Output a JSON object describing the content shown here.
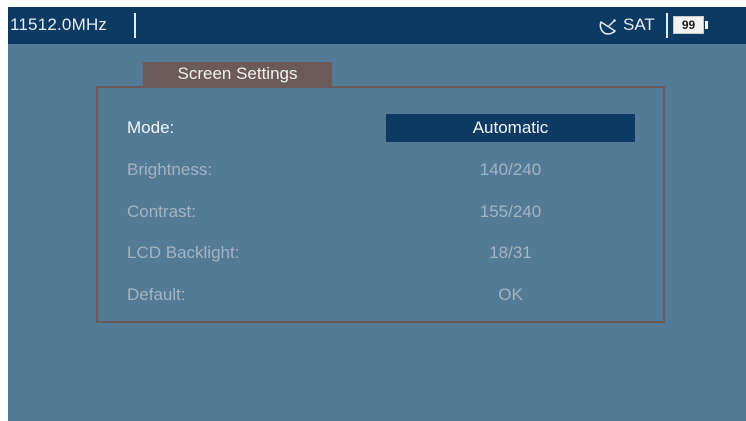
{
  "status_bar": {
    "frequency": "11512.0MHz",
    "mode": "SAT",
    "battery": "99",
    "satellite_icon": "satellite-dish-icon",
    "battery_icon": "battery-icon"
  },
  "panel": {
    "title": "Screen Settings",
    "rows": [
      {
        "label": "Mode:",
        "value": "Automatic",
        "selected": true
      },
      {
        "label": "Brightness:",
        "value": "140/240",
        "selected": false
      },
      {
        "label": "Contrast:",
        "value": "155/240",
        "selected": false
      },
      {
        "label": "LCD Backlight:",
        "value": "18/31",
        "selected": false
      },
      {
        "label": "Default:",
        "value": "OK",
        "selected": false
      }
    ]
  },
  "colors": {
    "background": "#537b96",
    "header": "#0d3a63",
    "selection": "#0d3a63",
    "panel_border": "#6b5a57",
    "active_text": "#f3f6f9",
    "inactive_text": "#a4b3c0"
  }
}
